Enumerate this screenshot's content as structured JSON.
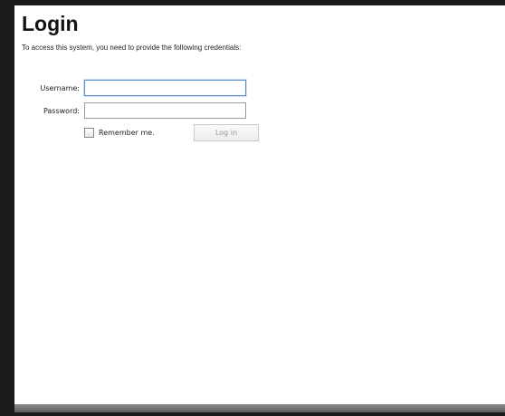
{
  "page": {
    "title": "Login",
    "intro": "To access this system, you need to provide the following credentials:"
  },
  "form": {
    "username_label": "Username:",
    "username_value": "",
    "password_label": "Password:",
    "password_value": "",
    "remember_label": "Remember me.",
    "remember_checked": false,
    "login_button": "Log in"
  }
}
